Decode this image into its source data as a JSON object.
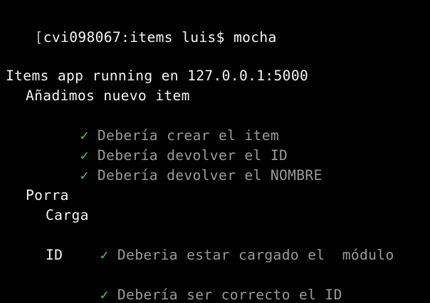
{
  "terminal": {
    "prompt_bracket": "[",
    "prompt": "cvi098067:items luis$ mocha",
    "server_message": "Items app running en 127.0.0.1:5000",
    "check_glyph": "✓",
    "suites": [
      {
        "title": "Añadimos nuevo item",
        "tests": [
          "Debería crear el item",
          "Debería devolver el ID",
          "Debería devolver el NOMBRE"
        ]
      },
      {
        "title": "Porra",
        "subsuites": [
          {
            "title": "Carga",
            "tests": [
              "Deberia estar cargado el  módulo"
            ]
          },
          {
            "title": "ID",
            "tests": [
              "Debería ser correcto el ID"
            ]
          }
        ]
      }
    ]
  },
  "colors": {
    "background": "#000000",
    "text": "#f2f2f2",
    "passed_test_text": "#9a9a9a",
    "check_mark": "#4ec94e"
  }
}
